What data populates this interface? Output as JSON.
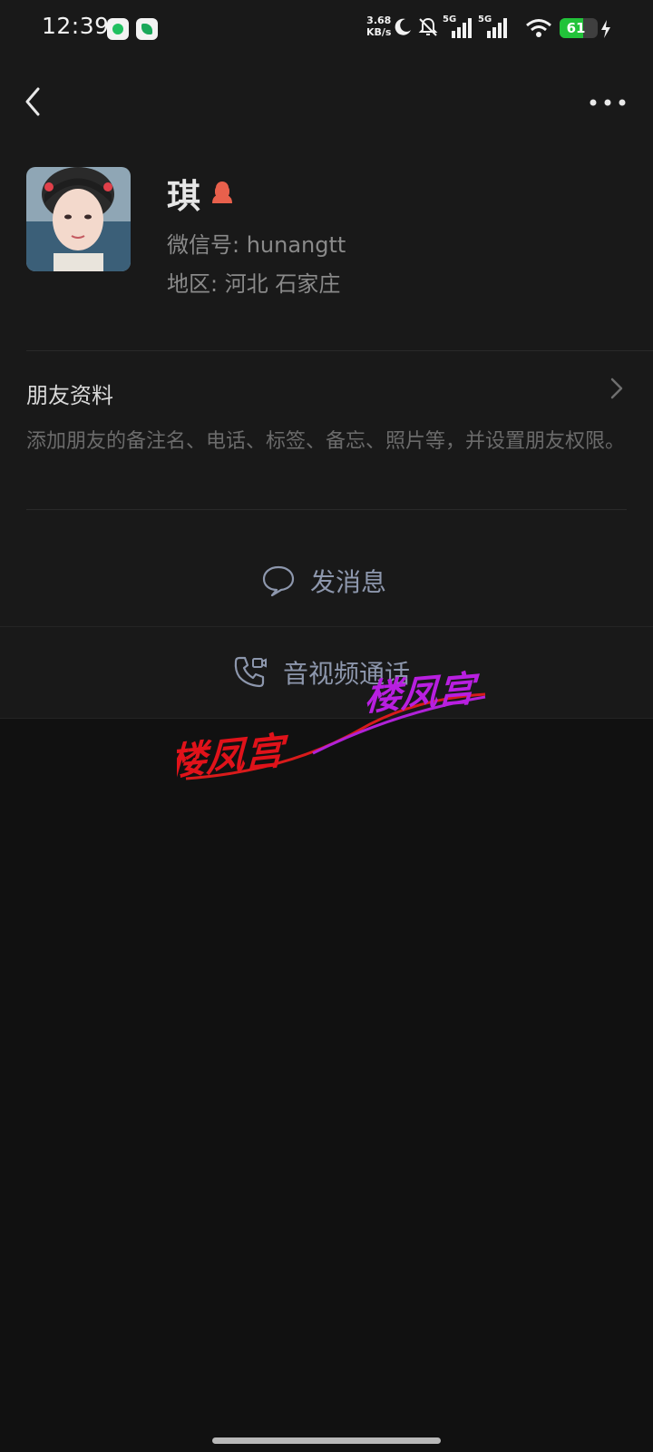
{
  "status_bar": {
    "time": "12:39",
    "net_speed_value": "3.68",
    "net_speed_unit": "KB/s",
    "sim1_label": "5G",
    "sim2_label": "5G",
    "battery_level": "61",
    "icons": [
      "wechat-app-icon",
      "leaf-app-icon",
      "moon-icon",
      "bell-off-icon",
      "signal-icon",
      "signal-icon",
      "wifi-icon",
      "battery-icon",
      "charging-icon"
    ]
  },
  "nav": {
    "back_icon": "chevron-left-icon",
    "more_icon": "more-dots-icon"
  },
  "profile": {
    "name": "琪",
    "gender_icon": "female-icon",
    "wechat_id": "微信号: hunangtt",
    "region": "地区: 河北  石家庄"
  },
  "friend_info": {
    "title": "朋友资料",
    "description": "添加朋友的备注名、电话、标签、备忘、照片等，并设置朋友权限。"
  },
  "actions": {
    "send_message": "发消息",
    "av_call": "音视频通话"
  },
  "watermark": {
    "text_red": "楼凤宫",
    "text_purple": "楼凤宫"
  },
  "colors": {
    "background": "#111111",
    "card": "#191919",
    "action_text": "#8d97ad",
    "battery": "#22c33a",
    "gender": "#e8604c"
  }
}
